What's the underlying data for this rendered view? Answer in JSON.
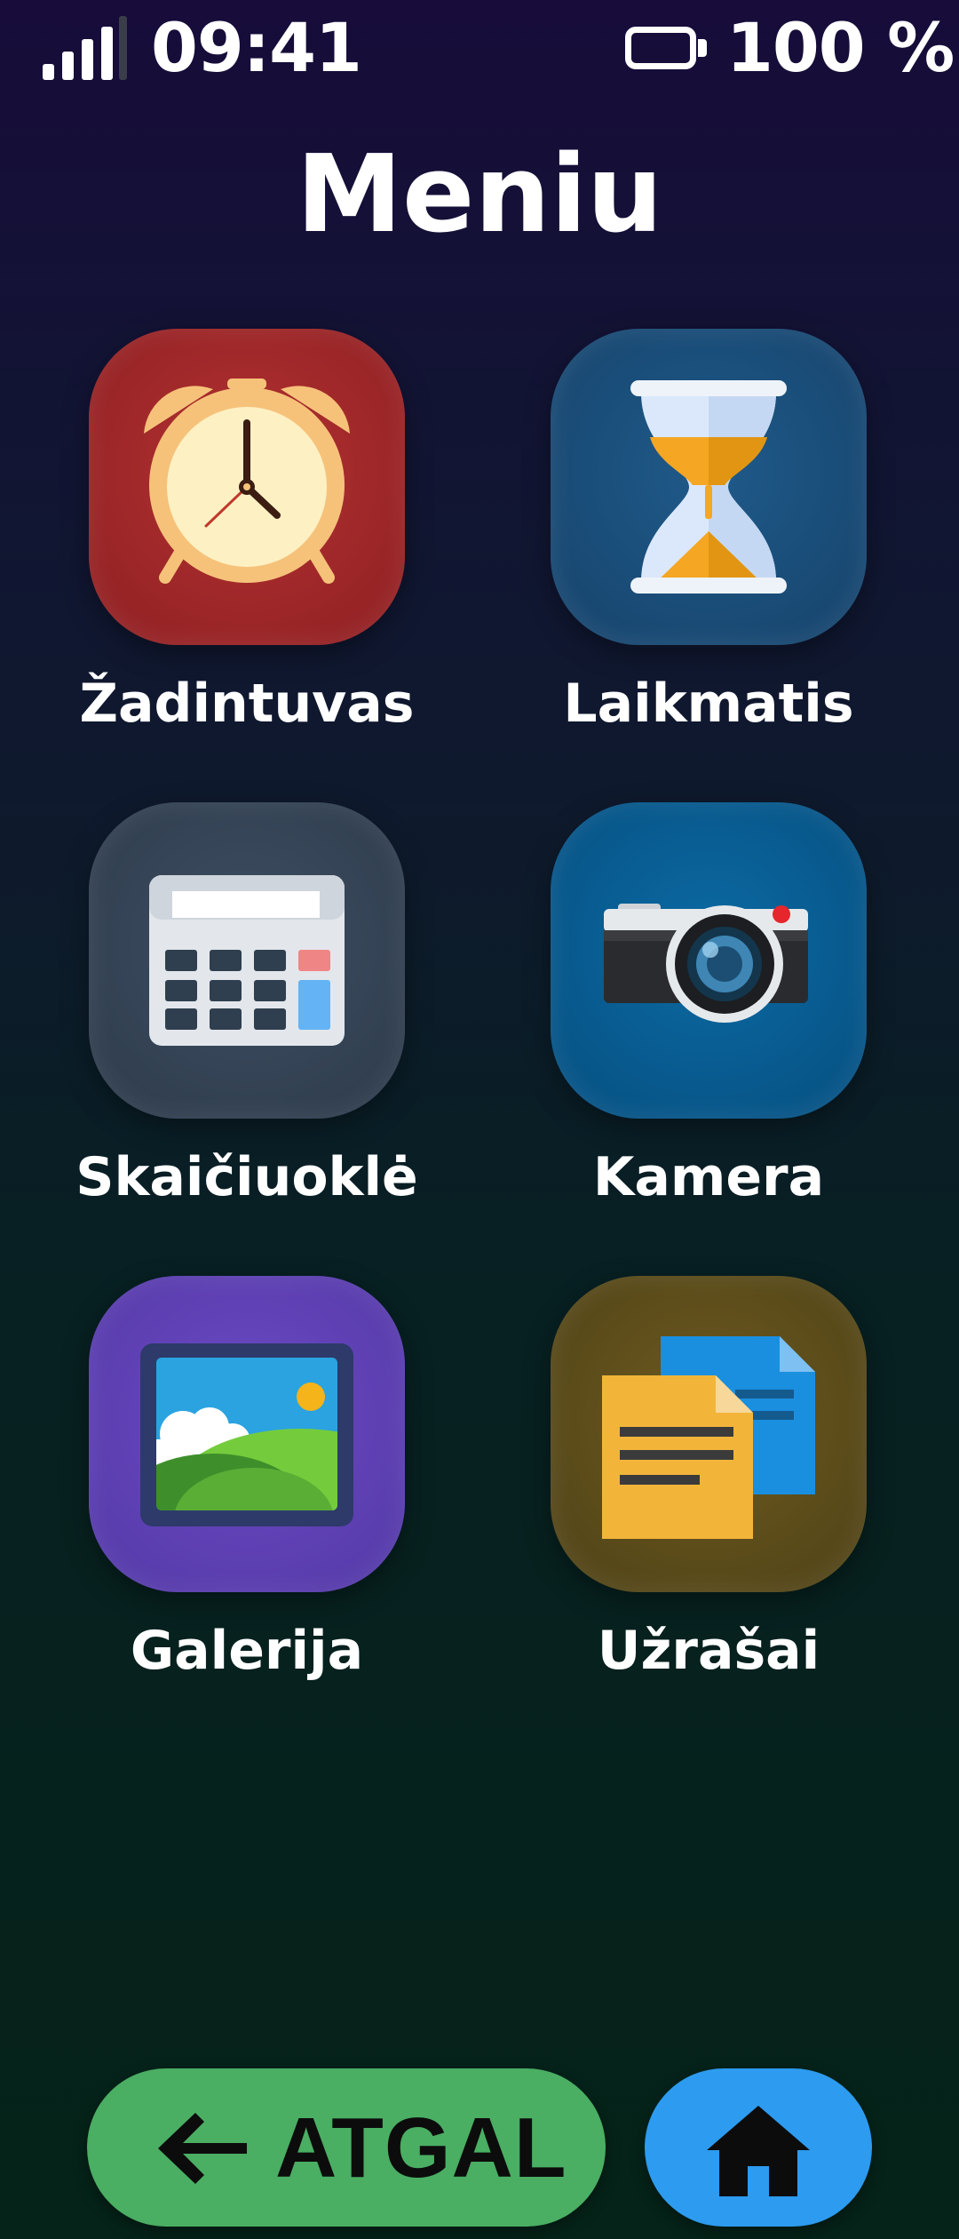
{
  "status_bar": {
    "time": "09:41",
    "battery_text": "100 %",
    "signal_icon": "signal-bars-icon",
    "battery_icon": "battery-full-icon"
  },
  "title": "Meniu",
  "apps": [
    {
      "label": "Žadintuvas",
      "icon": "alarm-clock-icon",
      "color": "#8e1f22"
    },
    {
      "label": "Laikmatis",
      "icon": "hourglass-icon",
      "color": "#16436b"
    },
    {
      "label": "Skaičiuoklė",
      "icon": "calculator-icon",
      "color": "#2d3a4b"
    },
    {
      "label": "Kamera",
      "icon": "camera-icon",
      "color": "#064f80"
    },
    {
      "label": "Galerija",
      "icon": "picture-icon",
      "color": "#5238a6"
    },
    {
      "label": "Užrašai",
      "icon": "notes-icon",
      "color": "#4e4217"
    }
  ],
  "navigation": {
    "back_label": "ATGAL",
    "back_icon": "arrow-left-icon",
    "back_color": "#4aae63",
    "home_icon": "home-icon",
    "home_color": "#2d9bef"
  }
}
